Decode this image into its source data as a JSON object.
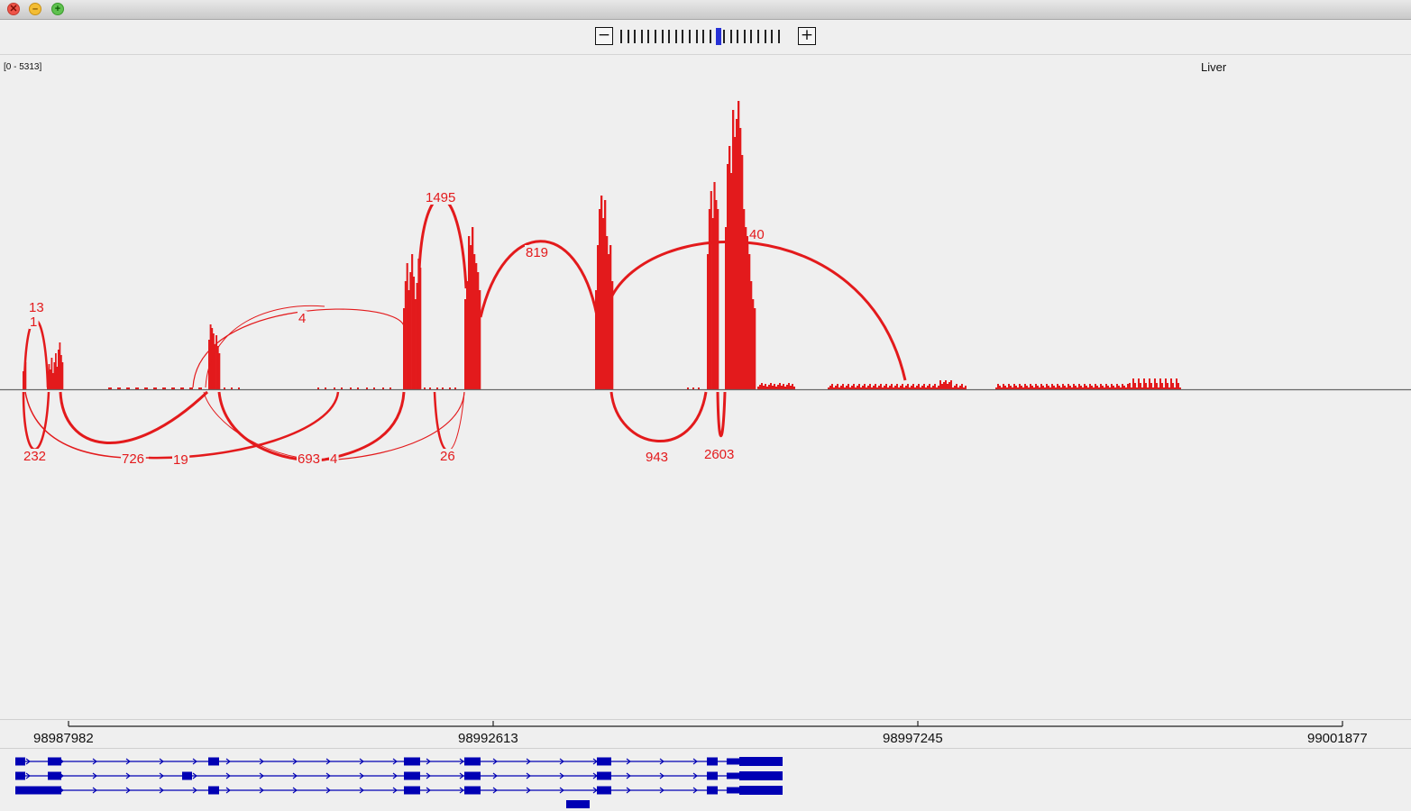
{
  "window": {
    "close_icon": "✕",
    "minimize_icon": "–",
    "maximize_icon": "+"
  },
  "zoom": {
    "minus_label": "−",
    "plus_label": "+",
    "tick_count": 24,
    "selected_index": 14
  },
  "track": {
    "range_label": "[0 - 5313]",
    "name": "Liver",
    "color": "#e31a1c"
  },
  "junction_labels": [
    "13",
    "1",
    "1495",
    "4",
    "819",
    "40",
    "232",
    "726",
    "19",
    "693",
    "4",
    "26",
    "943",
    "2603"
  ],
  "ruler": {
    "ticks": [
      "98987982",
      "98992613",
      "98997245",
      "99001877"
    ]
  },
  "colors": {
    "coverage": "#e31a1c",
    "gene": "#0000b4",
    "background": "#efefef"
  }
}
